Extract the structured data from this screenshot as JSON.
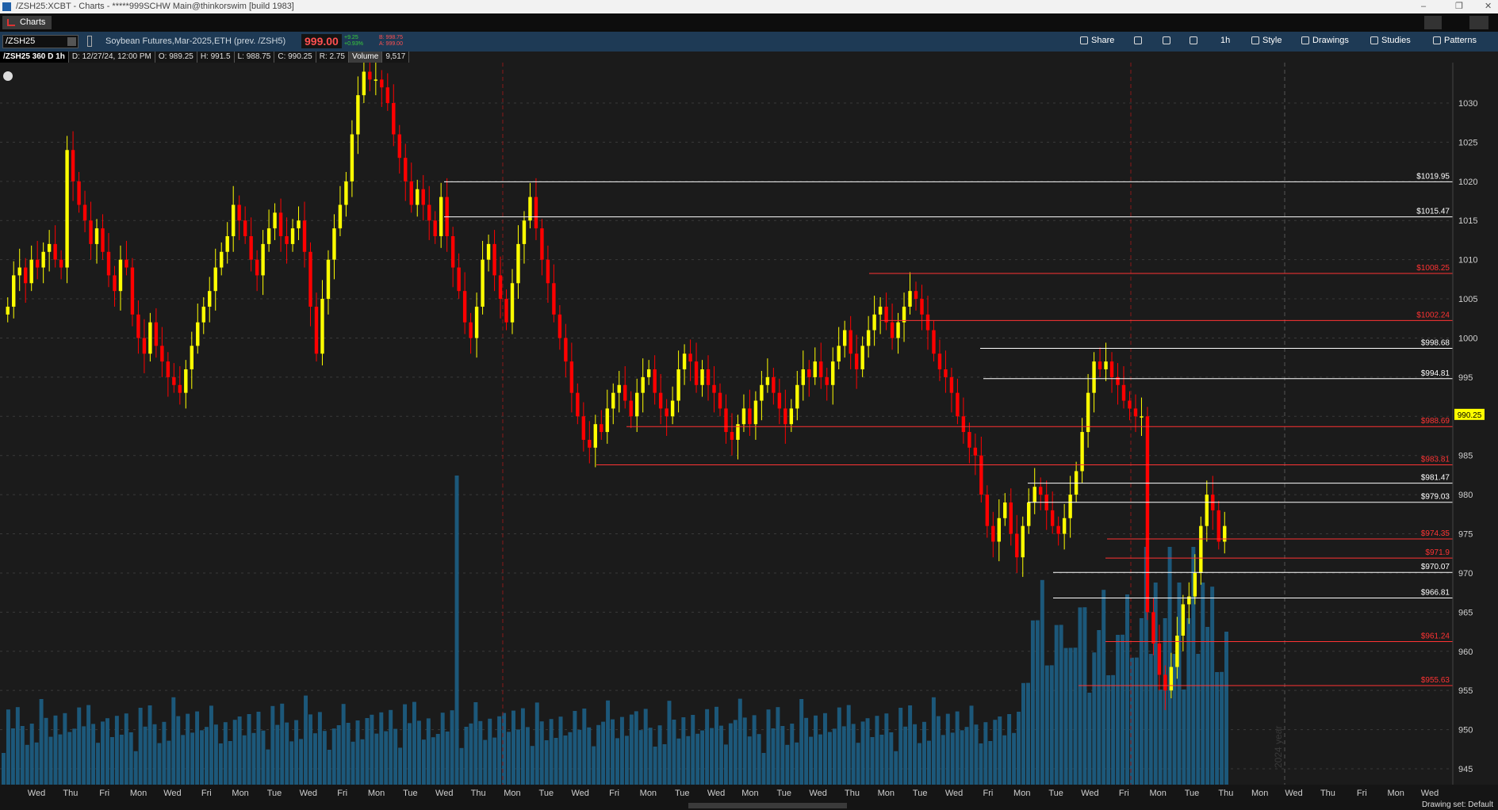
{
  "window": {
    "title": "/ZSH25:XCBT - Charts - *****999SCHW Main@thinkorswim [build 1983]"
  },
  "tab": {
    "label": "Charts"
  },
  "toolbar": {
    "symbol": "/ZSH25",
    "description": "Soybean Futures,Mar-2025,ETH (prev. /ZSH5)",
    "last_price": "999.00",
    "net_change": "+9.25",
    "pct_change": "+0.93%",
    "bid": "B: 998.75",
    "ask": "A: 999.00",
    "buttons": {
      "share": "Share",
      "timeframe": "1h",
      "style": "Style",
      "drawings": "Drawings",
      "studies": "Studies",
      "patterns": "Patterns"
    }
  },
  "info": {
    "symbol_label": "/ZSH25 360 D 1h",
    "date": "D: 12/27/24, 12:00 PM",
    "open": "O: 989.25",
    "high": "H: 991.5",
    "low": "L: 988.75",
    "close": "C: 990.25",
    "range": "R: 2.75",
    "volume_label": "Volume",
    "volume_value": "9,517"
  },
  "status": {
    "drawing_set": "Drawing set: Default"
  },
  "colors": {
    "up": "#ffff00",
    "down": "#ff0000",
    "volume": "#1d5f85",
    "background": "#1b1b1b",
    "price_tag": "#ffff00"
  },
  "chart_data": {
    "type": "candlestick",
    "ylim": [
      942,
      1034
    ],
    "y_ticks": [
      945,
      950,
      955,
      960,
      965,
      970,
      975,
      980,
      985,
      990,
      995,
      1000,
      1005,
      1010,
      1015,
      1020,
      1025,
      1030
    ],
    "x_labels": [
      "Wed",
      "Thu",
      "Fri",
      "Mon",
      "Wed",
      "Fri",
      "Mon",
      "Tue",
      "Wed",
      "Fri",
      "Mon",
      "Tue",
      "Wed",
      "Thu",
      "Mon",
      "Tue",
      "Wed",
      "Fri",
      "Mon",
      "Tue",
      "Wed",
      "Mon",
      "Tue",
      "Wed",
      "Thu",
      "Mon",
      "Tue",
      "Wed",
      "Fri",
      "Mon",
      "Tue",
      "Wed",
      "Fri",
      "Mon",
      "Tue",
      "Thu",
      "Mon",
      "Wed",
      "Thu",
      "Fri",
      "Mon",
      "Wed"
    ],
    "last_price_label": "990.25",
    "watermark": "2024 year",
    "price_levels": [
      {
        "label": "$1019.95",
        "value": 1019.95,
        "color": "#ffffff"
      },
      {
        "label": "$1015.47",
        "value": 1015.47,
        "color": "#ffffff"
      },
      {
        "label": "$1008.25",
        "value": 1008.25,
        "color": "#ff3333"
      },
      {
        "label": "$1002.24",
        "value": 1002.24,
        "color": "#ff3333"
      },
      {
        "label": "$998.68",
        "value": 998.68,
        "color": "#ffffff"
      },
      {
        "label": "$994.81",
        "value": 994.81,
        "color": "#ffffff"
      },
      {
        "label": "$988.69",
        "value": 988.69,
        "color": "#ff3333"
      },
      {
        "label": "$983.81",
        "value": 983.81,
        "color": "#ff3333"
      },
      {
        "label": "$981.47",
        "value": 981.47,
        "color": "#ffffff"
      },
      {
        "label": "$979.03",
        "value": 979.03,
        "color": "#ffffff"
      },
      {
        "label": "$974.35",
        "value": 974.35,
        "color": "#ff3333"
      },
      {
        "label": "$971.9",
        "value": 971.9,
        "color": "#ff3333"
      },
      {
        "label": "$970.07",
        "value": 970.07,
        "color": "#ffffff"
      },
      {
        "label": "$966.81",
        "value": 966.81,
        "color": "#ffffff"
      },
      {
        "label": "$961.24",
        "value": 961.24,
        "color": "#ff3333"
      },
      {
        "label": "$955.63",
        "value": 955.63,
        "color": "#ff3333"
      }
    ],
    "closes_approx": [
      1004,
      1008,
      1009,
      1007,
      1010,
      1009,
      1011,
      1012,
      1010,
      1009,
      1024,
      1020,
      1017,
      1015,
      1012,
      1014,
      1011,
      1008,
      1006,
      1010,
      1009,
      1003,
      1000,
      998,
      1002,
      999,
      997,
      995,
      994,
      993,
      996,
      999,
      1002,
      1004,
      1006,
      1009,
      1011,
      1013,
      1017,
      1015,
      1013,
      1010,
      1008,
      1012,
      1014,
      1016,
      1013,
      1012,
      1014,
      1015,
      1011,
      1004,
      998,
      1005,
      1010,
      1014,
      1017,
      1020,
      1026,
      1031,
      1034,
      1033,
      1033,
      1032,
      1030,
      1026,
      1023,
      1020,
      1017,
      1019,
      1017,
      1015,
      1013,
      1018,
      1013,
      1009,
      1006,
      1002,
      1000,
      1004,
      1010,
      1012,
      1008,
      1005,
      1002,
      1007,
      1012,
      1015,
      1018,
      1014,
      1010,
      1007,
      1003,
      1000,
      997,
      993,
      990,
      987,
      986,
      989,
      988,
      991,
      993,
      994,
      992,
      990,
      993,
      995,
      996,
      993,
      991,
      990,
      992,
      996,
      998,
      997,
      994,
      996,
      994,
      993,
      991,
      988,
      987,
      989,
      991,
      989,
      992,
      994,
      995,
      993,
      991,
      989,
      991,
      994,
      996,
      995,
      997,
      995,
      994,
      997,
      999,
      1001,
      998,
      996,
      999,
      1001,
      1003,
      1004,
      1002,
      1000,
      1002,
      1004,
      1006,
      1005,
      1003,
      1001,
      998,
      996,
      995,
      993,
      990,
      988,
      986,
      985,
      980,
      976,
      974,
      977,
      979,
      975,
      972,
      976,
      979,
      981,
      980,
      978,
      976,
      975,
      977,
      980,
      983,
      988,
      993,
      997,
      996,
      997,
      995,
      994,
      992,
      991,
      990,
      990,
      965,
      961,
      957,
      955,
      958,
      962,
      966,
      967,
      970,
      976,
      980,
      978,
      974,
      976
    ]
  }
}
